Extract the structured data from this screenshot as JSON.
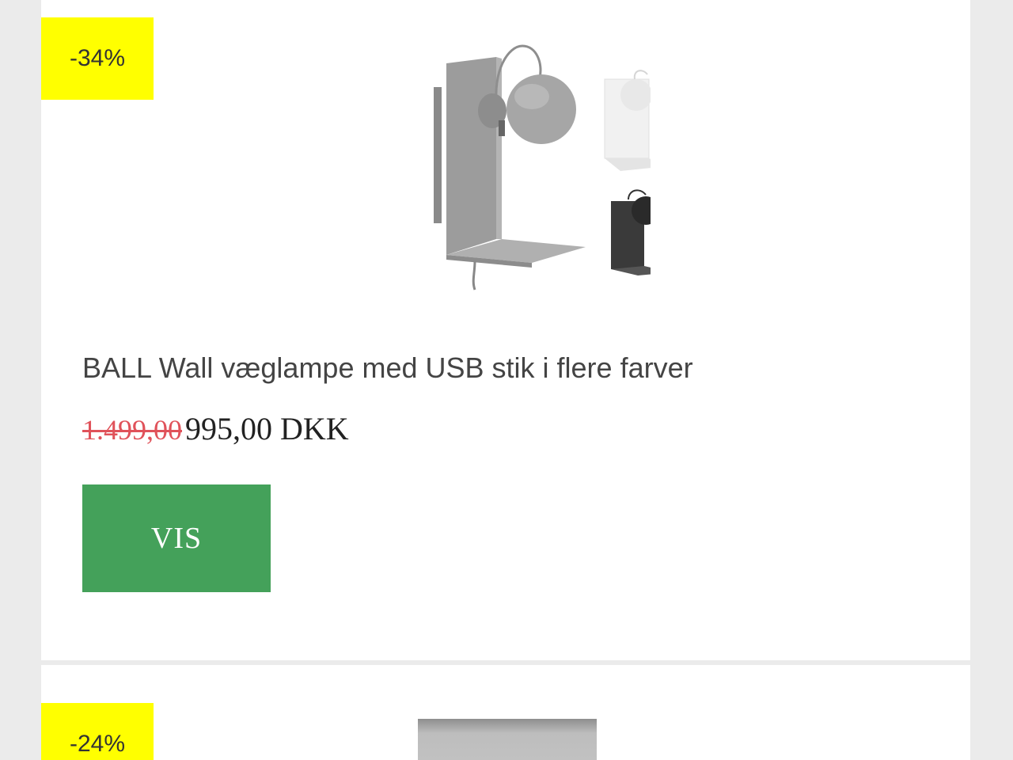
{
  "products": [
    {
      "discount_label": "-34%",
      "image_icon": "wall-lamp-image",
      "title": "BALL Wall væglampe med USB stik i flere farver",
      "old_price": "1.499,00",
      "new_price": "995,00 DKK",
      "button_label": "VIS"
    },
    {
      "discount_label": "-24%",
      "image_icon": "product-image"
    }
  ],
  "colors": {
    "page_background": "#ebebeb",
    "card_background": "#ffffff",
    "badge_background": "#ffff00",
    "button_background": "#44a15a",
    "old_price": "#e0525a"
  }
}
